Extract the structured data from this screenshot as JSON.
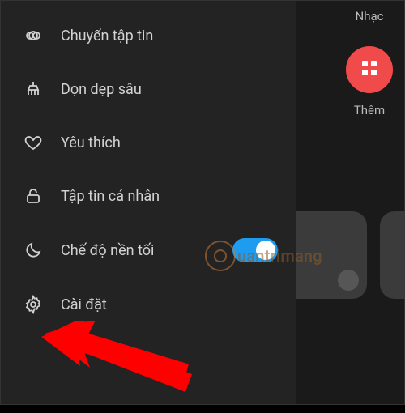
{
  "background": {
    "music_label": "Nhạc",
    "more_label": "Thêm"
  },
  "drawer": {
    "items": [
      {
        "label": "Chuyển tập tin"
      },
      {
        "label": "Dọn dẹp sâu"
      },
      {
        "label": "Yêu thích"
      },
      {
        "label": "Tập tin cá nhân"
      },
      {
        "label": "Chế độ nền tối"
      },
      {
        "label": "Cài đặt"
      }
    ],
    "dark_mode_on": true
  },
  "watermark": {
    "text": "uantrimang"
  }
}
